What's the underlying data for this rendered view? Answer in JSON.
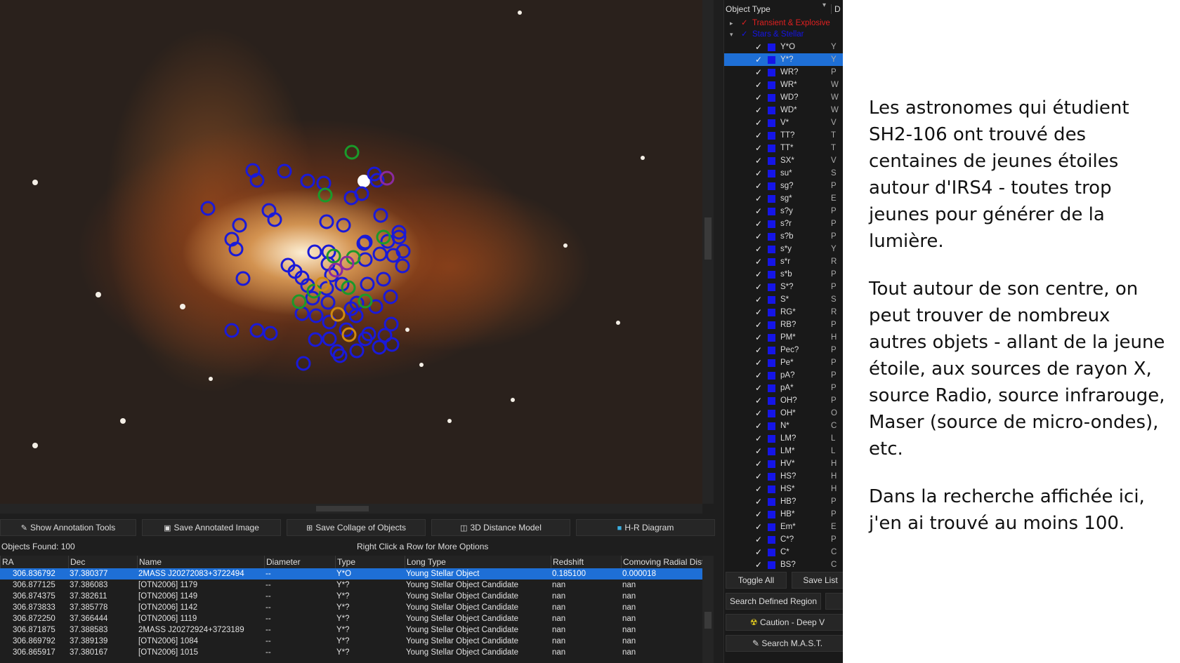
{
  "sidebar": {
    "header_left": "Object Type",
    "header_right": "D",
    "group_transient": "Transient & Explosive",
    "group_stars": "Stars & Stellar",
    "items": [
      {
        "label": "Y*O",
        "desc": "Y"
      },
      {
        "label": "Y*?",
        "desc": "Y"
      },
      {
        "label": "WR?",
        "desc": "P"
      },
      {
        "label": "WR*",
        "desc": "W"
      },
      {
        "label": "WD?",
        "desc": "W"
      },
      {
        "label": "WD*",
        "desc": "W"
      },
      {
        "label": "V*",
        "desc": "V"
      },
      {
        "label": "TT?",
        "desc": "T"
      },
      {
        "label": "TT*",
        "desc": "T"
      },
      {
        "label": "SX*",
        "desc": "V"
      },
      {
        "label": "su*",
        "desc": "S"
      },
      {
        "label": "sg?",
        "desc": "P"
      },
      {
        "label": "sg*",
        "desc": "E"
      },
      {
        "label": "s?y",
        "desc": "P"
      },
      {
        "label": "s?r",
        "desc": "P"
      },
      {
        "label": "s?b",
        "desc": "P"
      },
      {
        "label": "s*y",
        "desc": "Y"
      },
      {
        "label": "s*r",
        "desc": "R"
      },
      {
        "label": "s*b",
        "desc": "P"
      },
      {
        "label": "S*?",
        "desc": "P"
      },
      {
        "label": "S*",
        "desc": "S"
      },
      {
        "label": "RG*",
        "desc": "R"
      },
      {
        "label": "RB?",
        "desc": "P"
      },
      {
        "label": "PM*",
        "desc": "H"
      },
      {
        "label": "Pec?",
        "desc": "P"
      },
      {
        "label": "Pe*",
        "desc": "P"
      },
      {
        "label": "pA?",
        "desc": "P"
      },
      {
        "label": "pA*",
        "desc": "P"
      },
      {
        "label": "OH?",
        "desc": "P"
      },
      {
        "label": "OH*",
        "desc": "O"
      },
      {
        "label": "N*",
        "desc": "C"
      },
      {
        "label": "LM?",
        "desc": "L"
      },
      {
        "label": "LM*",
        "desc": "L"
      },
      {
        "label": "HV*",
        "desc": "H"
      },
      {
        "label": "HS?",
        "desc": "H"
      },
      {
        "label": "HS*",
        "desc": "H"
      },
      {
        "label": "HB?",
        "desc": "P"
      },
      {
        "label": "HB*",
        "desc": "P"
      },
      {
        "label": "Em*",
        "desc": "E"
      },
      {
        "label": "C*?",
        "desc": "P"
      },
      {
        "label": "C*",
        "desc": "C"
      },
      {
        "label": "BS?",
        "desc": "C"
      }
    ],
    "toggle_all": "Toggle All",
    "save_list": "Save List",
    "search_region": "Search Defined Region",
    "caution": "Caution - Deep V",
    "search_mast": "Search M.A.S.T."
  },
  "toolbar": {
    "annotation_tools": "Show Annotation Tools",
    "save_annotated": "Save Annotated Image",
    "save_collage": "Save Collage of Objects",
    "distance_model": "3D Distance Model",
    "hr_diagram": "H-R Diagram"
  },
  "results": {
    "found": "Objects Found: 100",
    "hint": "Right Click a Row for More Options",
    "columns": [
      "RA",
      "Dec",
      "Name",
      "Diameter",
      "Type",
      "Long Type",
      "Redshift",
      "Comoving Radial Dist"
    ],
    "rows": [
      [
        "306.836792",
        "37.380377",
        "2MASS J20272083+3722494",
        "--",
        "Y*O",
        "Young Stellar Object",
        "0.185100",
        "0.000018"
      ],
      [
        "306.877125",
        "37.386083",
        "[OTN2006] 1179",
        "--",
        "Y*?",
        "Young Stellar Object Candidate",
        "nan",
        "nan"
      ],
      [
        "306.874375",
        "37.382611",
        "[OTN2006] 1149",
        "--",
        "Y*?",
        "Young Stellar Object Candidate",
        "nan",
        "nan"
      ],
      [
        "306.873833",
        "37.385778",
        "[OTN2006] 1142",
        "--",
        "Y*?",
        "Young Stellar Object Candidate",
        "nan",
        "nan"
      ],
      [
        "306.872250",
        "37.366444",
        "[OTN2006] 1119",
        "--",
        "Y*?",
        "Young Stellar Object Candidate",
        "nan",
        "nan"
      ],
      [
        "306.871875",
        "37.388583",
        "2MASS J20272924+3723189",
        "--",
        "Y*?",
        "Young Stellar Object Candidate",
        "nan",
        "nan"
      ],
      [
        "306.869792",
        "37.389139",
        "[OTN2006] 1084",
        "--",
        "Y*?",
        "Young Stellar Object Candidate",
        "nan",
        "nan"
      ],
      [
        "306.865917",
        "37.380167",
        "[OTN2006] 1015",
        "--",
        "Y*?",
        "Young Stellar Object Candidate",
        "nan",
        "nan"
      ]
    ]
  },
  "caption": {
    "p1": "Les astronomes qui étudient SH2-106 ont trouvé des centaines de jeunes étoiles autour d'IRS4 - toutes trop jeunes pour générer de la lumière.",
    "p2": "Tout autour de son centre, on peut trouver de nombreux autres objets - allant de la jeune étoile, aux sources de rayon X, source Radio, source infrarouge, Maser (source de micro-ondes), etc.",
    "p3": "Dans la recherche affichée ici, j'en ai trouvé au moins 100."
  },
  "colors": {
    "marker_blue": "#1a1ad8",
    "marker_green": "#1a9a2a",
    "marker_purple": "#8a2aa0",
    "marker_orange": "#d08a10",
    "selection": "#1e6fd6",
    "transient_red": "#e02020"
  }
}
